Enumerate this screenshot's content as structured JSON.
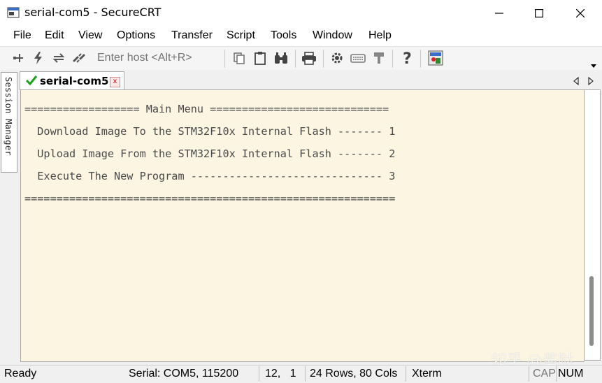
{
  "window": {
    "title": "serial-com5 - SecureCRT",
    "minimize_glyph": "—",
    "maximize_glyph": "☐",
    "close_glyph": "✕"
  },
  "menu": [
    "File",
    "Edit",
    "View",
    "Options",
    "Transfer",
    "Script",
    "Tools",
    "Window",
    "Help"
  ],
  "toolbar": {
    "host_placeholder": "Enter host <Alt+R>",
    "icons": [
      "connect-icon",
      "quick-connect-icon",
      "reconnect-icon",
      "disconnect-icon",
      "copy-icon",
      "paste-icon",
      "find-icon",
      "print-icon",
      "settings-icon",
      "keymap-icon",
      "sftp-icon",
      "help-icon",
      "about-icon"
    ]
  },
  "session_manager": {
    "label": "Session Manager"
  },
  "tab": {
    "label": "serial-com5",
    "close_glyph": "x",
    "status_color": "#1aa01a"
  },
  "terminal": {
    "lines": [
      "================== Main Menu ============================",
      "  Download Image To the STM32F10x Internal Flash ------- 1",
      "  Upload Image From the STM32F10x Internal Flash ------- 2",
      "  Execute The New Program ------------------------------ 3",
      "=========================================================="
    ],
    "background": "#fbf5e1",
    "foreground": "#4a4a4a"
  },
  "status": {
    "ready": "Ready",
    "serial": "Serial: COM5, 115200",
    "cursor": "12,   1",
    "size": "24 Rows, 80 Cols",
    "term": "Xterm",
    "cap": "CAP",
    "num": "NUM"
  },
  "watermark": "知乎 @酱哒"
}
